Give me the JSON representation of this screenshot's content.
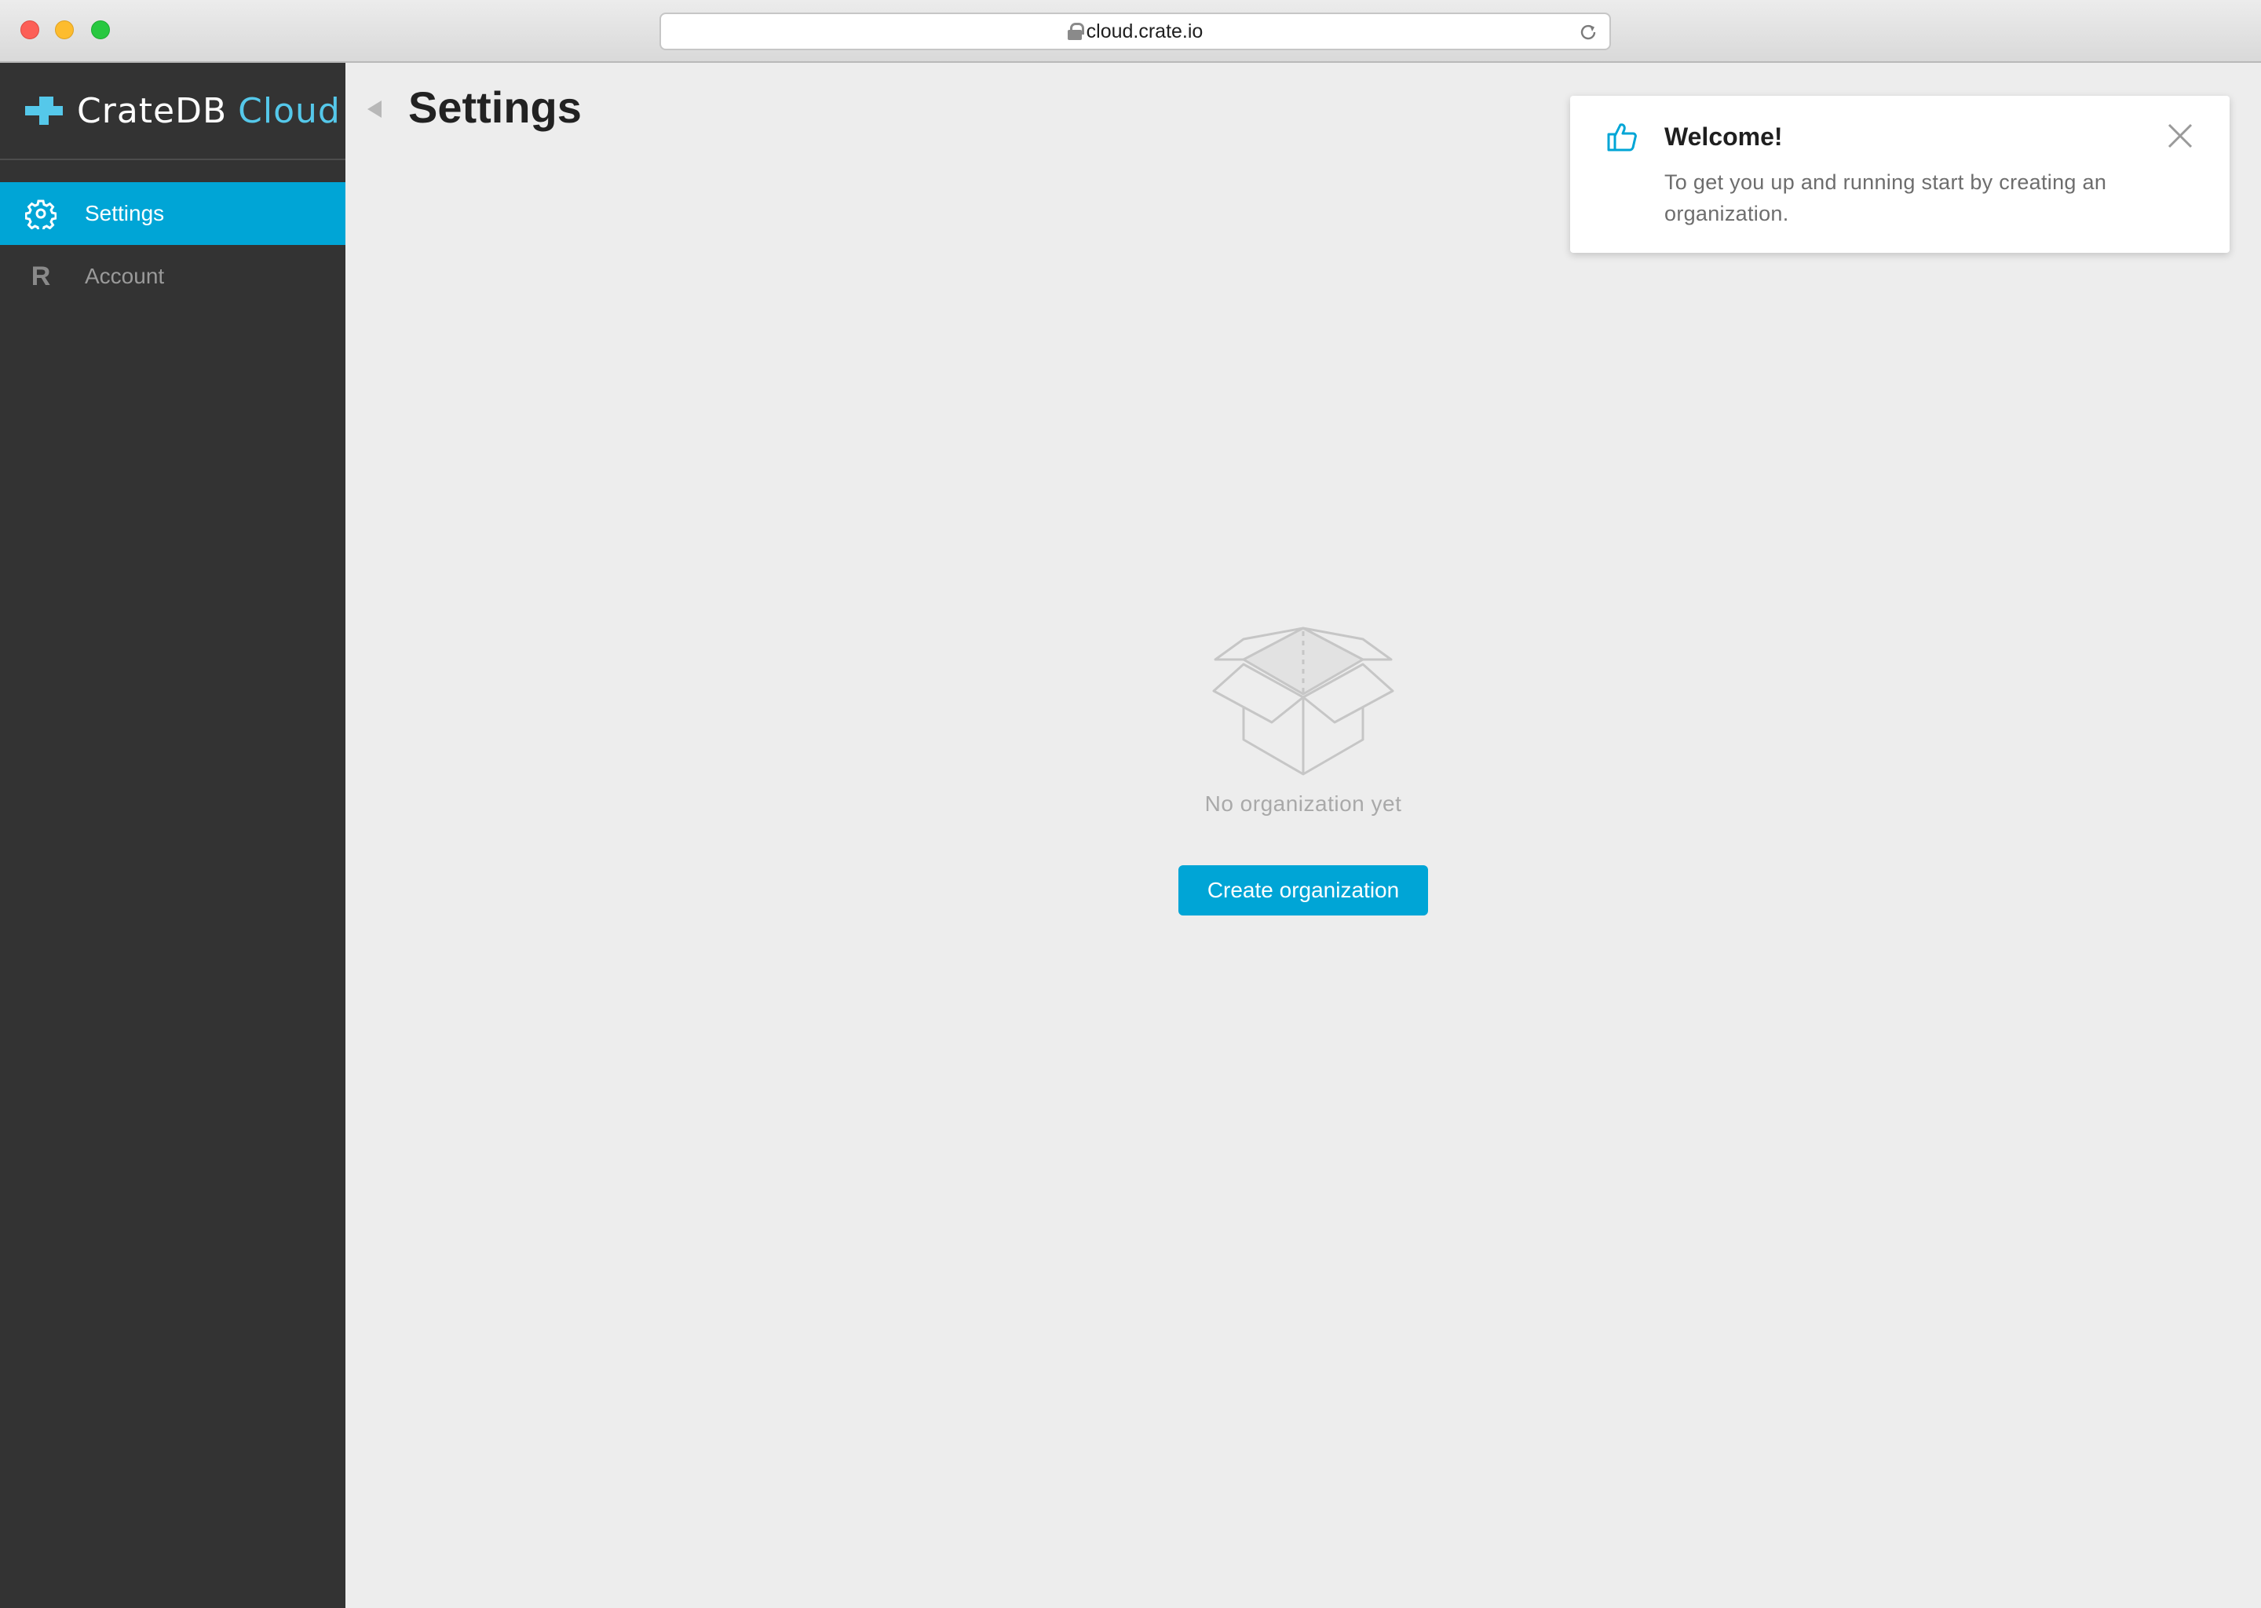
{
  "browser": {
    "url": "cloud.crate.io"
  },
  "brand": {
    "name": "CrateDB",
    "accent": "Cloud",
    "accent_color": "#55c8ea"
  },
  "sidebar": {
    "items": [
      {
        "label": "Settings",
        "icon": "gear-icon",
        "active": true
      },
      {
        "label": "Account",
        "icon": "R",
        "active": false
      }
    ]
  },
  "main": {
    "title": "Settings",
    "empty_state": {
      "icon": "open-box-icon",
      "text": "No organization yet",
      "button_label": "Create organization"
    }
  },
  "toast": {
    "icon": "thumbs-up-icon",
    "title": "Welcome!",
    "message": "To get you up and running start by creating an organization."
  },
  "colors": {
    "primary": "#00a5d6",
    "sidebar_bg": "#333333",
    "page_bg": "#ededed"
  }
}
